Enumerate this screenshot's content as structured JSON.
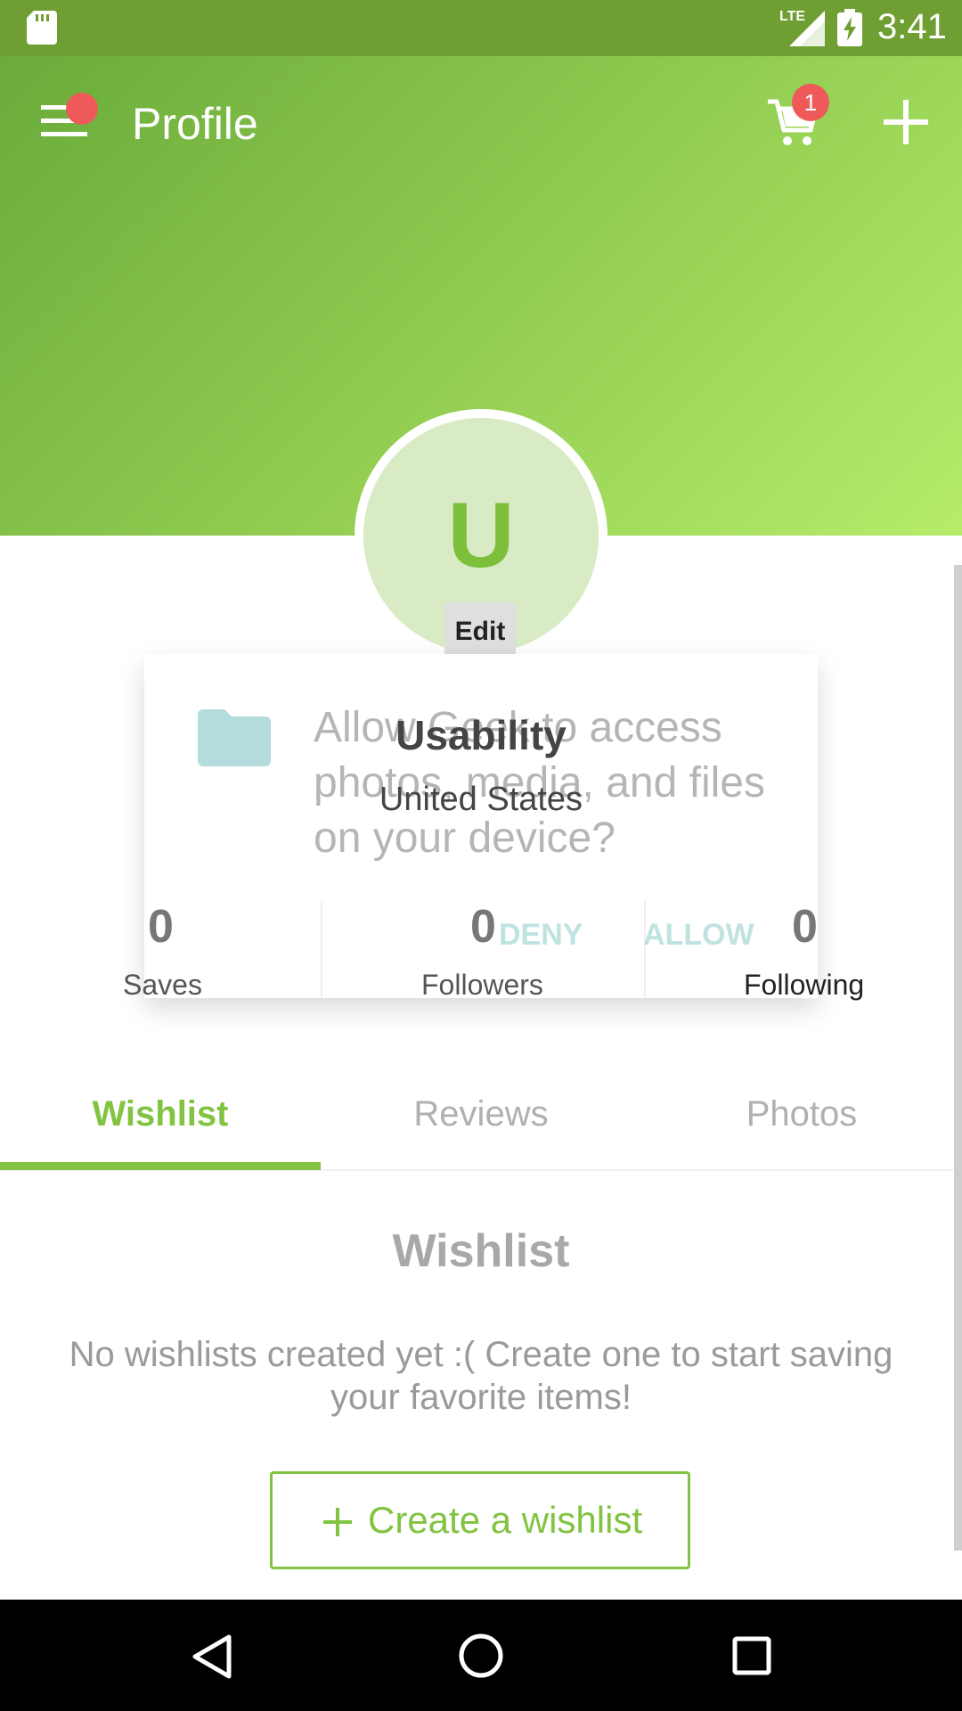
{
  "status_bar": {
    "time": "3:41",
    "network": "LTE",
    "icons": [
      "sd-card-icon",
      "signal-icon",
      "battery-charging-icon"
    ]
  },
  "header": {
    "title": "Profile",
    "cart_count": "1",
    "icons": [
      "menu-icon",
      "cart-icon",
      "add-icon"
    ],
    "brand_color": "#82c341",
    "badge_color": "#ee5a5a"
  },
  "profile": {
    "avatar_letter": "U",
    "edit_label": "Edit",
    "name": "Usability",
    "location": "United States",
    "stats": [
      {
        "count": "0",
        "label": "Saves"
      },
      {
        "count": "0",
        "label": "Followers"
      },
      {
        "count": "0",
        "label": "Following"
      }
    ]
  },
  "permission_dialog": {
    "message": "Allow Geek to access photos, media, and files on your device?",
    "deny_label": "DENY",
    "allow_label": "ALLOW",
    "icon": "folder-icon"
  },
  "tabs": [
    {
      "label": "Wishlist",
      "active": true
    },
    {
      "label": "Reviews",
      "active": false
    },
    {
      "label": "Photos",
      "active": false
    }
  ],
  "wishlist": {
    "heading": "Wishlist",
    "empty_text": "No wishlists created yet :( Create one to start saving your favorite items!",
    "create_button_label": "Create a wishlist"
  },
  "nav_bar": {
    "icons": [
      "back-icon",
      "home-icon",
      "recents-icon"
    ]
  }
}
